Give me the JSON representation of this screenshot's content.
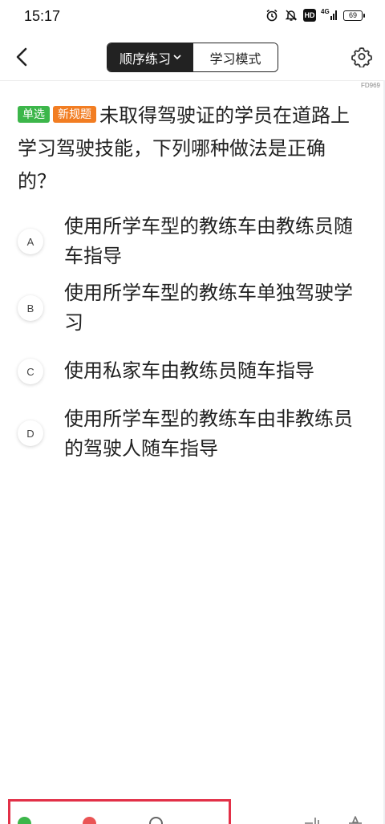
{
  "status_bar": {
    "time": "15:17",
    "network": "4G",
    "battery": "69",
    "hd": "HD",
    "icons": [
      "alarm-icon",
      "bell-mute-icon",
      "hd-icon",
      "signal-icon",
      "battery-icon"
    ]
  },
  "header": {
    "tabs": [
      {
        "label": "顺序练习",
        "active": true
      },
      {
        "label": "学习模式",
        "active": false
      }
    ],
    "question_code": "FD969"
  },
  "question": {
    "type_tag": "单选",
    "new_tag": "新规题",
    "text": "未取得驾驶证的学员在道路上学习驾驶技能，下列哪种做法是正确的？"
  },
  "options": [
    {
      "letter": "A",
      "text": "使用所学车型的教练车由教练员随车指导"
    },
    {
      "letter": "B",
      "text": "使用所学车型的教练车单独驾驶学习"
    },
    {
      "letter": "C",
      "text": "使用私家车由教练员随车指导"
    },
    {
      "letter": "D",
      "text": "使用所学车型的教练车由非教练员的驾驶人随车指导"
    }
  ],
  "colors": {
    "tag_type": "#3cb64a",
    "tag_new": "#f27d22",
    "correct": "#3cb64a",
    "wrong": "#ea5455",
    "highlight": "#e23047",
    "active_tab_bg": "#222222"
  }
}
